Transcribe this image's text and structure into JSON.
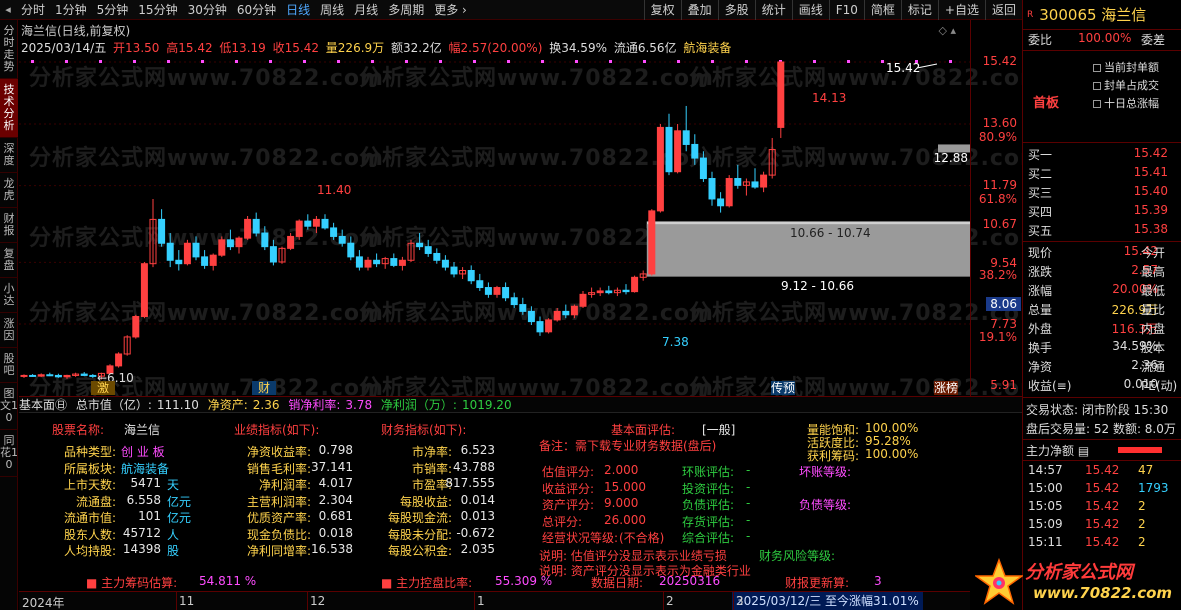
{
  "toolbar": {
    "periods": [
      "分时",
      "1分钟",
      "5分钟",
      "15分钟",
      "30分钟",
      "60分钟",
      "日线",
      "周线",
      "月线",
      "多周期",
      "更多 ›"
    ],
    "active_period": "日线",
    "buttons": [
      "复权",
      "叠加",
      "多股",
      "统计",
      "画线",
      "F10",
      "简框",
      "标记",
      "+自选",
      "返回"
    ]
  },
  "left_tabs": [
    "分时走势",
    "技术分析",
    "深度",
    "龙虎",
    "财报",
    "复盘",
    "小达",
    "涨因",
    "股吧",
    "图文10",
    "同花10"
  ],
  "left_tabs_active": "技术分析",
  "chart": {
    "title": "海兰信(日线,前复权)",
    "quote": {
      "date": "2025/03/14/五",
      "open": "开13.50",
      "high": "高15.42",
      "low": "低13.19",
      "close": "收15.42",
      "volume": "量226.9万",
      "amount": "额32.2亿",
      "change": "幅2.57(20.00%)",
      "turnover": "换34.59%",
      "float": "流通6.56亿",
      "concept": "航海装备"
    },
    "corner": "◇ ▴",
    "annotations": {
      "low_label": "←6.10",
      "high_label_1": "11.40",
      "low_label_2": "7.38",
      "high_label_2": "14.13",
      "high_label_3": "15.42",
      "arrow_price": "12.88",
      "zone_1": "10.66 - 10.74",
      "zone_2": "9.12 - 10.66",
      "tag_ji": "激",
      "tag_cai": "财",
      "tag_chuanyu": "传预",
      "tag_zhangbang": "涨榜"
    },
    "watermark": "分析家公式网www.70822.com",
    "y_axis": [
      {
        "text": "15.42",
        "color": "red"
      },
      {
        "text": "13.60",
        "color": "red"
      },
      {
        "text": "80.9%",
        "color": "red"
      },
      {
        "text": "12.88",
        "color": "white"
      },
      {
        "text": "11.79",
        "color": "red"
      },
      {
        "text": "61.8%",
        "color": "red"
      },
      {
        "text": "10.67",
        "color": "red"
      },
      {
        "text": "9.54",
        "color": "red"
      },
      {
        "text": "38.2%",
        "color": "red"
      },
      {
        "text": "8.06",
        "color": "white"
      },
      {
        "text": "7.73",
        "color": "red"
      },
      {
        "text": "19.1%",
        "color": "red"
      },
      {
        "text": "5.91",
        "color": "red"
      }
    ]
  },
  "fundbar": {
    "title": "基本面㊐",
    "market_cap_label": "总市值（亿）:",
    "market_cap": "111.10",
    "net_assets_label": "净资产:",
    "net_assets": "2.36",
    "net_margin_label": "销净利率:",
    "net_margin": "3.78",
    "net_profit_label": "净利润（万）:",
    "net_profit": "1019.20"
  },
  "fund": {
    "col1_header": "股票名称:",
    "col1_header_val": "海兰信",
    "col1": [
      {
        "label": "品种类型:",
        "value": "创 业 板",
        "vc": "m"
      },
      {
        "label": "所属板块:",
        "value": "航海装备",
        "vc": "c"
      },
      {
        "label": "上市天数:",
        "value": "5471",
        "unit": "天"
      },
      {
        "label": "流通盘:",
        "value": "6.558",
        "unit": "亿元"
      },
      {
        "label": "流通市值:",
        "value": "101",
        "unit": "亿元"
      },
      {
        "label": "股东人数:",
        "value": "45712",
        "unit": "人"
      },
      {
        "label": "人均持股:",
        "value": "14398",
        "unit": "股"
      }
    ],
    "col2_header": "业绩指标(如下):",
    "col2": [
      {
        "label": "净资收益率:",
        "value": "0.798"
      },
      {
        "label": "销售毛利率:",
        "value": "37.141"
      },
      {
        "label": "净利润率:",
        "value": "4.017"
      },
      {
        "label": "主营利润率:",
        "value": "2.304"
      },
      {
        "label": "优质资产率:",
        "value": "0.681"
      },
      {
        "label": "现金负债比:",
        "value": "0.018"
      },
      {
        "label": "净利同增率:",
        "value": "16.538"
      }
    ],
    "col3_header": "财务指标(如下):",
    "col3": [
      {
        "label": "市净率:",
        "value": "6.523"
      },
      {
        "label": "市销率:",
        "value": "43.788"
      },
      {
        "label": "市盈率:",
        "value": "817.555"
      },
      {
        "label": "每股收益:",
        "value": "0.014"
      },
      {
        "label": "每股现金流:",
        "value": "0.013"
      },
      {
        "label": "每股未分配:",
        "value": "-0.672"
      },
      {
        "label": "每股公积金:",
        "value": "2.035"
      }
    ],
    "eval_label": "基本面评估:",
    "eval_value": "[一般]",
    "eval_note": "备注：需下载专业财务数据(盘后)",
    "scores": [
      {
        "label": "估值评分:",
        "value": "2.000"
      },
      {
        "label": "收益评分:",
        "value": "15.000"
      },
      {
        "label": "资产评分:",
        "value": "9.000"
      },
      {
        "label": "总评分:",
        "value": "26.000"
      },
      {
        "label": "经营状况等级:",
        "value": "(不合格)"
      }
    ],
    "evals": [
      {
        "label": "环账评估:",
        "value": "-"
      },
      {
        "label": "投资评估:",
        "value": "-"
      },
      {
        "label": "负债评估:",
        "value": "-"
      },
      {
        "label": "存货评估:",
        "value": "-"
      },
      {
        "label": "综合评估:",
        "value": "-"
      }
    ],
    "grade_1": "坏账等级:",
    "grade_2": "负债等级:",
    "grade_3": "财务风险等级:",
    "energy": [
      {
        "label": "量能饱和:",
        "value": "100.00%"
      },
      {
        "label": "活跃度比:",
        "value": "95.28%"
      },
      {
        "label": "获利筹码:",
        "value": "100.00%"
      }
    ],
    "note_1": "说明: 估值评分没显示表示业绩亏损",
    "note_2": "说明: 资产评分没显示表示为金融类行业",
    "bottom": {
      "chip_label": "■ 主力筹码估算:",
      "chip_value": "54.811 %",
      "control_label": "■ 主力控盘比率:",
      "control_value": "55.309 %",
      "date_label": "数据日期:",
      "date_value": "20250316",
      "update_label": "财报更新算:",
      "update_value": "3"
    }
  },
  "timeline": {
    "labels": [
      "2024年",
      "11",
      "12",
      "1",
      "2",
      "3"
    ],
    "status": "2025/03/12/三  至今涨幅31.01%"
  },
  "right": {
    "mark": "R",
    "code_name": "300065 海兰信",
    "weibi_label": "委比",
    "weibi_value": "100.00%",
    "weicha_label": "委差",
    "checks": [
      "当前封单额",
      "封单占成交",
      "十日总涨幅"
    ],
    "first_board": "首板",
    "bids": [
      {
        "label": "买一",
        "price": "15.42"
      },
      {
        "label": "买二",
        "price": "15.41"
      },
      {
        "label": "买三",
        "price": "15.40"
      },
      {
        "label": "买四",
        "price": "15.39"
      },
      {
        "label": "买五",
        "price": "15.38"
      }
    ],
    "quote_rows": [
      {
        "a": "现价",
        "b": "15.42",
        "bc": "red",
        "c": "今开"
      },
      {
        "a": "涨跌",
        "b": "2.57",
        "bc": "red",
        "c": "最高"
      },
      {
        "a": "涨幅",
        "b": "20.00%",
        "bc": "red",
        "c": "最低"
      },
      {
        "a": "总量",
        "b": "226.9万",
        "bc": "yel",
        "c": "量比"
      },
      {
        "a": "外盘",
        "b": "116.3万",
        "bc": "red",
        "c": "内盘"
      },
      {
        "a": "换手",
        "b": "34.59%",
        "bc": "wht",
        "c": "股本"
      },
      {
        "a": "净资",
        "b": "2.36",
        "bc": "wht",
        "c": "流通"
      },
      {
        "a": "收益(≡)",
        "b": "0.010",
        "bc": "wht",
        "c": "PE(动)"
      }
    ],
    "trade_status": "交易状态: 闭市阶段 15:30",
    "after_hours": "盘后交易量: 52  数额: 8.0万",
    "main_net_label": "主力净额",
    "ticks": [
      {
        "time": "14:57",
        "price": "15.42",
        "vol": "47"
      },
      {
        "time": "15:00",
        "price": "15.42",
        "vol": "1793"
      },
      {
        "time": "15:05",
        "price": "15.42",
        "vol": "2"
      },
      {
        "time": "15:09",
        "price": "15.42",
        "vol": "2"
      },
      {
        "time": "15:11",
        "price": "15.42",
        "vol": "2"
      }
    ]
  },
  "logo": {
    "name": "分析家公式网",
    "url": "www.70822.com"
  },
  "colors": {
    "up": "#ff4040",
    "down": "#35d0ff",
    "frame": "#5a0000",
    "accent_yellow": "#ffd34d",
    "accent_magenta": "#ff4cff"
  },
  "chart_data": {
    "type": "candlestick",
    "y_range": [
      5.91,
      15.42
    ],
    "candles": [
      [
        6.2,
        6.25,
        6.15,
        6.22
      ],
      [
        6.22,
        6.26,
        6.18,
        6.2
      ],
      [
        6.2,
        6.28,
        6.17,
        6.24
      ],
      [
        6.24,
        6.3,
        6.2,
        6.22
      ],
      [
        6.22,
        6.27,
        6.15,
        6.18
      ],
      [
        6.18,
        6.24,
        6.12,
        6.22
      ],
      [
        6.22,
        6.3,
        6.18,
        6.26
      ],
      [
        6.26,
        6.32,
        6.2,
        6.22
      ],
      [
        6.22,
        6.26,
        6.15,
        6.2
      ],
      [
        6.2,
        6.3,
        6.1,
        6.28
      ],
      [
        6.28,
        6.55,
        6.25,
        6.5
      ],
      [
        6.5,
        6.9,
        6.45,
        6.85
      ],
      [
        6.85,
        7.4,
        6.8,
        7.35
      ],
      [
        7.35,
        8.0,
        7.3,
        7.95
      ],
      [
        7.95,
        9.55,
        7.9,
        9.5
      ],
      [
        9.5,
        11.4,
        9.4,
        10.8
      ],
      [
        10.8,
        11.1,
        10.0,
        10.1
      ],
      [
        10.1,
        10.4,
        9.4,
        9.6
      ],
      [
        9.6,
        9.9,
        9.3,
        9.5
      ],
      [
        9.5,
        10.2,
        9.45,
        10.1
      ],
      [
        10.1,
        10.3,
        9.6,
        9.7
      ],
      [
        9.7,
        9.9,
        9.35,
        9.45
      ],
      [
        9.45,
        9.8,
        9.3,
        9.75
      ],
      [
        9.75,
        10.3,
        9.7,
        10.2
      ],
      [
        10.2,
        10.5,
        9.9,
        10.0
      ],
      [
        10.0,
        10.3,
        9.8,
        10.25
      ],
      [
        10.25,
        10.9,
        10.2,
        10.8
      ],
      [
        10.8,
        11.0,
        10.3,
        10.4
      ],
      [
        10.4,
        10.6,
        9.9,
        10.0
      ],
      [
        10.0,
        10.2,
        9.45,
        9.55
      ],
      [
        9.55,
        10.0,
        9.5,
        9.95
      ],
      [
        9.95,
        10.4,
        9.9,
        10.3
      ],
      [
        10.3,
        10.8,
        10.2,
        10.75
      ],
      [
        10.75,
        10.95,
        10.5,
        10.6
      ],
      [
        10.6,
        10.9,
        10.4,
        10.8
      ],
      [
        10.8,
        10.95,
        10.5,
        10.55
      ],
      [
        10.55,
        10.7,
        10.2,
        10.3
      ],
      [
        10.3,
        10.5,
        10.0,
        10.1
      ],
      [
        10.1,
        10.3,
        9.6,
        9.7
      ],
      [
        9.7,
        9.9,
        9.3,
        9.4
      ],
      [
        9.4,
        9.7,
        9.3,
        9.6
      ],
      [
        9.6,
        9.8,
        9.4,
        9.5
      ],
      [
        9.5,
        9.7,
        9.35,
        9.65
      ],
      [
        9.65,
        9.8,
        9.4,
        9.45
      ],
      [
        9.45,
        9.7,
        9.3,
        9.6
      ],
      [
        9.6,
        10.2,
        9.55,
        10.1
      ],
      [
        10.1,
        10.4,
        9.9,
        10.0
      ],
      [
        10.0,
        10.2,
        9.7,
        9.8
      ],
      [
        9.8,
        9.95,
        9.5,
        9.6
      ],
      [
        9.6,
        9.75,
        9.3,
        9.4
      ],
      [
        9.4,
        9.55,
        9.1,
        9.2
      ],
      [
        9.2,
        9.4,
        9.05,
        9.3
      ],
      [
        9.3,
        9.45,
        8.9,
        9.0
      ],
      [
        9.0,
        9.2,
        8.7,
        8.8
      ],
      [
        8.8,
        8.95,
        8.5,
        8.6
      ],
      [
        8.6,
        8.85,
        8.5,
        8.8
      ],
      [
        8.8,
        8.95,
        8.4,
        8.5
      ],
      [
        8.5,
        8.65,
        8.2,
        8.3
      ],
      [
        8.3,
        8.5,
        8.0,
        8.1
      ],
      [
        8.1,
        8.25,
        7.7,
        7.8
      ],
      [
        7.8,
        7.95,
        7.38,
        7.5
      ],
      [
        7.5,
        7.9,
        7.45,
        7.85
      ],
      [
        7.85,
        8.2,
        7.8,
        8.1
      ],
      [
        8.1,
        8.3,
        7.9,
        8.0
      ],
      [
        8.0,
        8.3,
        7.9,
        8.25
      ],
      [
        8.25,
        8.7,
        8.2,
        8.6
      ],
      [
        8.6,
        8.8,
        8.5,
        8.65
      ],
      [
        8.65,
        8.8,
        8.55,
        8.7
      ],
      [
        8.7,
        8.85,
        8.6,
        8.65
      ],
      [
        8.65,
        8.8,
        8.55,
        8.72
      ],
      [
        8.72,
        8.9,
        8.6,
        8.68
      ],
      [
        8.68,
        9.15,
        8.65,
        9.1
      ],
      [
        9.1,
        9.3,
        9.0,
        9.2
      ],
      [
        9.2,
        11.1,
        9.15,
        11.05
      ],
      [
        11.05,
        13.6,
        11.0,
        13.5
      ],
      [
        13.5,
        13.9,
        12.1,
        12.2
      ],
      [
        12.2,
        13.6,
        12.15,
        13.4
      ],
      [
        13.4,
        14.13,
        12.8,
        13.0
      ],
      [
        13.0,
        13.3,
        12.4,
        12.6
      ],
      [
        12.6,
        12.8,
        11.9,
        12.0
      ],
      [
        12.0,
        12.2,
        11.2,
        11.4
      ],
      [
        11.4,
        11.6,
        11.0,
        11.2
      ],
      [
        11.2,
        12.1,
        11.15,
        12.0
      ],
      [
        12.0,
        12.4,
        11.7,
        11.8
      ],
      [
        11.8,
        12.0,
        11.5,
        11.9
      ],
      [
        11.9,
        12.3,
        11.7,
        11.75
      ],
      [
        11.75,
        12.2,
        11.6,
        12.1
      ],
      [
        12.1,
        13.19,
        12.0,
        12.85
      ],
      [
        13.5,
        15.42,
        13.19,
        15.42
      ]
    ]
  }
}
